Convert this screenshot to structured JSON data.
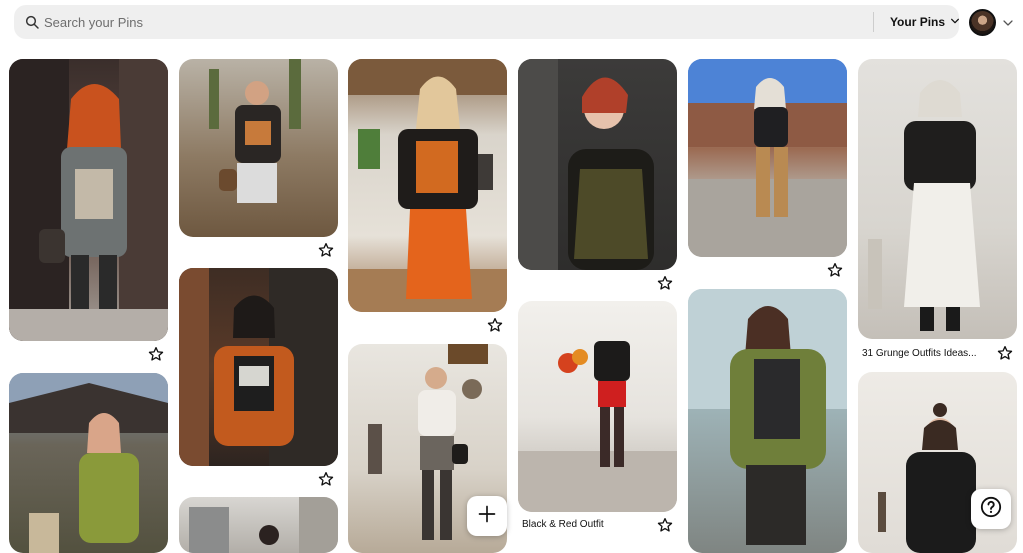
{
  "search": {
    "placeholder": "Search your Pins",
    "value": ""
  },
  "header": {
    "your_pins_label": "Your Pins",
    "avatar_icon": "avatar",
    "chevron_icon": "chevron-down-icon"
  },
  "pins": [
    {
      "title": ""
    },
    {
      "title": ""
    },
    {
      "title": ""
    },
    {
      "title": ""
    },
    {
      "title": ""
    },
    {
      "title": "31 Grunge Outfits Ideas..."
    },
    {
      "title": ""
    },
    {
      "title": ""
    },
    {
      "title": ""
    },
    {
      "title": "Black & Red Outfit"
    },
    {
      "title": ""
    },
    {
      "title": ""
    },
    {
      "title": ""
    },
    {
      "title": ""
    }
  ],
  "fab": {
    "add_icon": "plus-icon",
    "help_icon": "help-icon"
  }
}
